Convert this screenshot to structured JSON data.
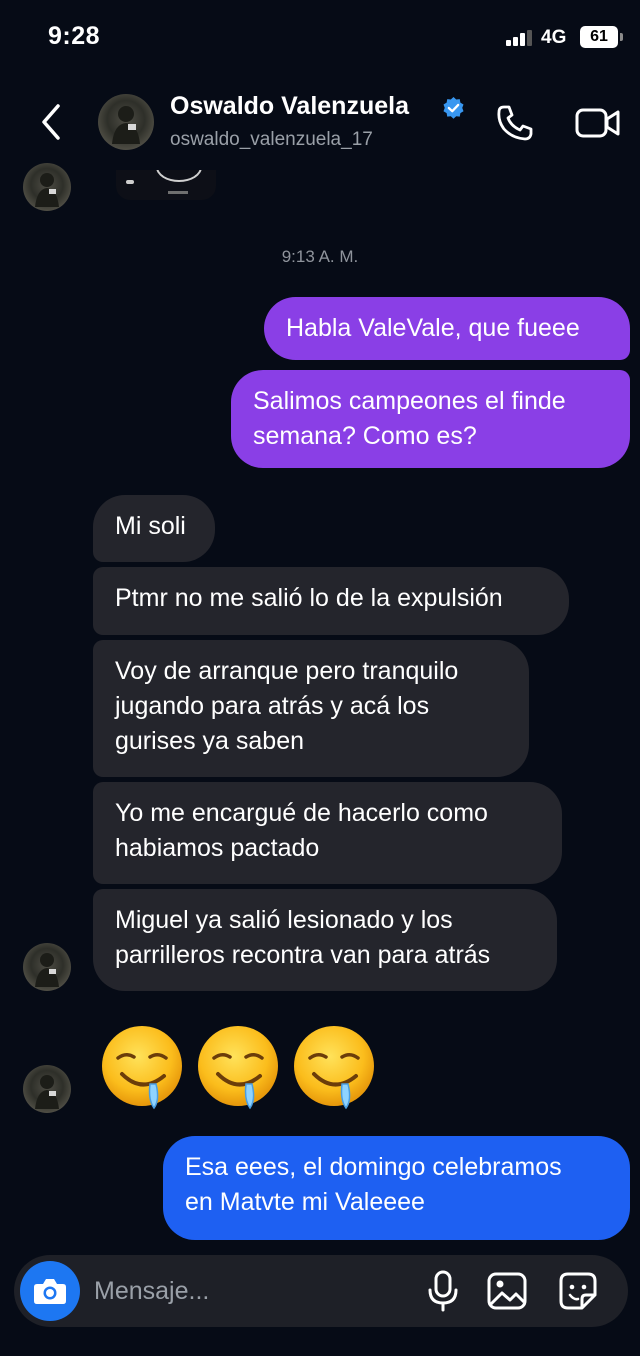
{
  "status_bar": {
    "time": "9:28",
    "network": "4G",
    "battery": "61"
  },
  "header": {
    "contact_name": "Oswaldo Valenzuela",
    "username": "oswaldo_valenzuela_17",
    "verified_color": "#3897f0"
  },
  "timestamp": "9:13 A. M.",
  "sent_messages": [
    "Habla ValeVale, que fueee",
    "Salimos campeones el finde",
    "semana? Como es?"
  ],
  "received_messages": [
    "Mi soli",
    "Ptmr no me salió lo de la expulsión",
    "Voy de arranque pero tranquilo",
    "jugando para atrás y acá los",
    "gurises ya saben",
    "Yo me encargué de hacerlo como",
    "habiamos pactado",
    "Miguel ya salió lesionado y los",
    "parrilleros recontra van para atrás"
  ],
  "reply_message": [
    "Esa eees, el domingo celebramos",
    "en Matvte mi Valeeee"
  ],
  "emojis": [
    "drooling-face",
    "drooling-face",
    "drooling-face"
  ],
  "composer": {
    "placeholder": "Mensaje..."
  },
  "colors": {
    "sent_bubble": "#8a3fe6",
    "reply_bubble": "#1e60f2",
    "received_bubble": "#24252c",
    "background": "#060b16",
    "camera_button": "#1d77f2"
  }
}
